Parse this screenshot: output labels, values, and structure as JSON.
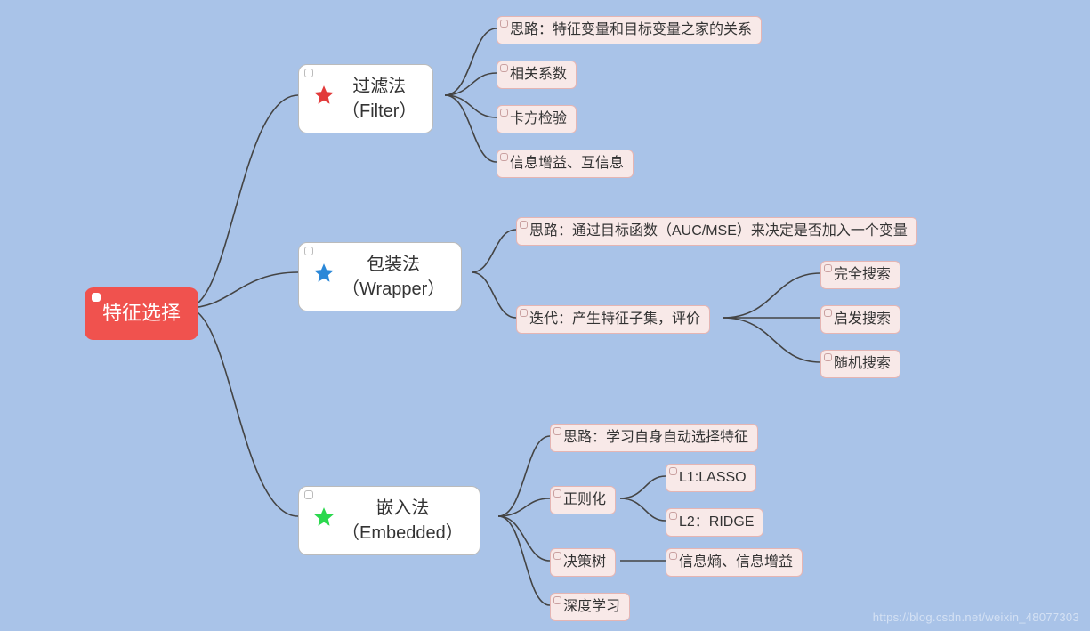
{
  "root": {
    "label": "特征选择"
  },
  "methods": {
    "filter": {
      "label_line1": "过滤法",
      "label_line2": "（Filter）",
      "star_color": "#e23b3b",
      "children": [
        "思路：特征变量和目标变量之家的关系",
        "相关系数",
        "卡方检验",
        "信息增益、互信息"
      ]
    },
    "wrapper": {
      "label_line1": "包装法",
      "label_line2": "（Wrapper）",
      "star_color": "#2b88d8",
      "children": {
        "idea": "思路：通过目标函数（AUC/MSE）来决定是否加入一个变量",
        "iter": {
          "label": "迭代：产生特征子集，评价",
          "children": [
            "完全搜索",
            "启发搜索",
            "随机搜索"
          ]
        }
      }
    },
    "embedded": {
      "label_line1": "嵌入法",
      "label_line2": "（Embedded）",
      "star_color": "#2bd84e",
      "children": {
        "idea": "思路：学习自身自动选择特征",
        "reg": {
          "label": "正则化",
          "children": [
            "L1:LASSO",
            "L2：RIDGE"
          ]
        },
        "tree": {
          "label": "决策树",
          "children": [
            "信息熵、信息增益"
          ]
        },
        "dl": "深度学习"
      }
    }
  },
  "watermark": "https://blog.csdn.net/weixin_48077303"
}
